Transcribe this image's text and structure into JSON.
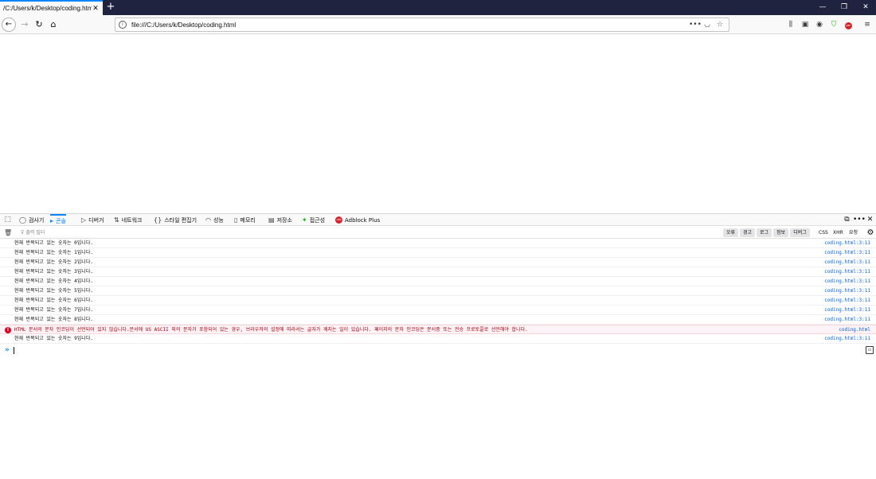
{
  "browser": {
    "tab_title": "/C:/Users/k/Desktop/coding.html",
    "tab_close": "✕",
    "new_tab": "+",
    "url": "file:///C:/Users/k/Desktop/coding.html",
    "window_controls": [
      "—",
      "❐",
      "✕"
    ]
  },
  "devtools": {
    "tabs": [
      {
        "icon": "◯",
        "label": "검사기"
      },
      {
        "icon": "▸",
        "label": "콘솔"
      },
      {
        "icon": "▷",
        "label": "디버거"
      },
      {
        "icon": "⇅",
        "label": "네트워크"
      },
      {
        "icon": "{}",
        "label": "스타일 편집기"
      },
      {
        "icon": "◠",
        "label": "성능"
      },
      {
        "icon": "▯",
        "label": "메모리"
      },
      {
        "icon": "▤",
        "label": "저장소"
      },
      {
        "icon": "✦",
        "label": "접근성"
      },
      {
        "icon": "ABP",
        "label": "Adblock Plus"
      }
    ],
    "active_tab": "콘솔"
  },
  "console": {
    "filter_placeholder": "출력 필터",
    "filter_buttons": [
      "오류",
      "경고",
      "로그",
      "정보",
      "디버그"
    ],
    "plain_filters": [
      "CSS",
      "XHR",
      "요청"
    ],
    "messages": [
      {
        "type": "log",
        "text": "현재 반복되고 있는 숫자는 0입니다.",
        "source": "coding.html:3:11"
      },
      {
        "type": "log",
        "text": "현재 반복되고 있는 숫자는 1입니다.",
        "source": "coding.html:3:11"
      },
      {
        "type": "log",
        "text": "현재 반복되고 있는 숫자는 2입니다.",
        "source": "coding.html:3:11"
      },
      {
        "type": "log",
        "text": "현재 반복되고 있는 숫자는 3입니다.",
        "source": "coding.html:3:11"
      },
      {
        "type": "log",
        "text": "현재 반복되고 있는 숫자는 4입니다.",
        "source": "coding.html:3:11"
      },
      {
        "type": "log",
        "text": "현재 반복되고 있는 숫자는 5입니다.",
        "source": "coding.html:3:11"
      },
      {
        "type": "log",
        "text": "현재 반복되고 있는 숫자는 6입니다.",
        "source": "coding.html:3:11"
      },
      {
        "type": "log",
        "text": "현재 반복되고 있는 숫자는 7입니다.",
        "source": "coding.html:3:11"
      },
      {
        "type": "log",
        "text": "현재 반복되고 있는 숫자는 8입니다.",
        "source": "coding.html:3:11"
      },
      {
        "type": "error",
        "text": "HTML 문서의 문자 인코딩이 선언되어 있지 않습니다.문서에 US ASCII 외의 문자가 포함되어 있는 경우, 브라우저의 설정에 따라서는 글자가 깨지는 일이 있습니다. 페이지의 문자 인코딩은 문서중 또는 전송 프로토콜로 선언해야 합니다.",
        "source": "coding.html"
      },
      {
        "type": "log",
        "text": "현재 반복되고 있는 숫자는 9입니다.",
        "source": "coding.html:3:11"
      }
    ],
    "prompt": "»"
  }
}
